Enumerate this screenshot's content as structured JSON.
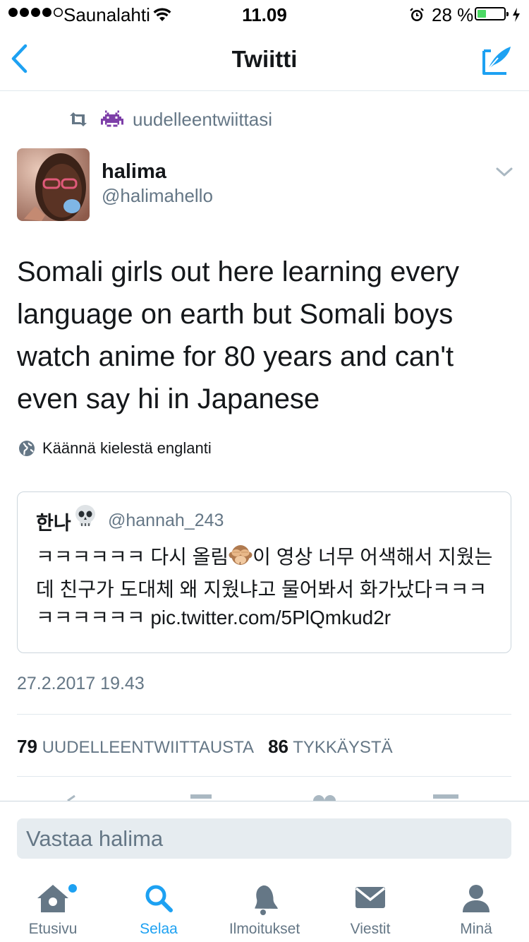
{
  "status_bar": {
    "carrier": "Saunalahti",
    "time": "11.09",
    "battery_percent": "28 %",
    "battery_level": 0.28
  },
  "nav": {
    "title": "Twiitti",
    "back_icon": "chevron-left-icon",
    "compose_icon": "compose-quill-icon"
  },
  "retweet": {
    "text": "uudelleentwiittasi",
    "icon": "retweet-icon",
    "emoji": "alien-monster-emoji"
  },
  "author": {
    "name": "halima",
    "handle": "@halimahello"
  },
  "tweet": {
    "text": "Somali girls out here learning every language on earth but Somali boys watch anime for 80 years and can't even say hi in Japanese"
  },
  "translate": {
    "label": "Käännä kielestä englanti"
  },
  "quoted": {
    "name": "한나",
    "handle": "@hannah_243",
    "text_part1": "ㅋㅋㅋㅋㅋㅋ 다시 올림",
    "text_part2": "이 영상 너무 어색해서 지웠는데 친구가 도대체 왜 지웠냐고 물어봐서 화가났다ㅋㅋㅋㅋㅋㅋㅋㅋㅋ pic.twitter.com/5PlQmkud2r"
  },
  "timestamp": "27.2.2017 19.43",
  "stats": {
    "retweets_count": "79",
    "retweets_label": "UUDELLEENTWIITTAUSTA",
    "likes_count": "86",
    "likes_label": "TYKKÄYSTÄ"
  },
  "reply": {
    "placeholder": "Vastaa halima"
  },
  "tabs": [
    {
      "label": "Etusivu",
      "icon": "home-icon"
    },
    {
      "label": "Selaa",
      "icon": "search-icon",
      "active": true
    },
    {
      "label": "Ilmoitukset",
      "icon": "bell-icon"
    },
    {
      "label": "Viestit",
      "icon": "envelope-icon"
    },
    {
      "label": "Minä",
      "icon": "person-icon"
    }
  ],
  "colors": {
    "accent": "#1da1f2",
    "secondary_text": "#657786",
    "primary_text": "#14171a"
  }
}
